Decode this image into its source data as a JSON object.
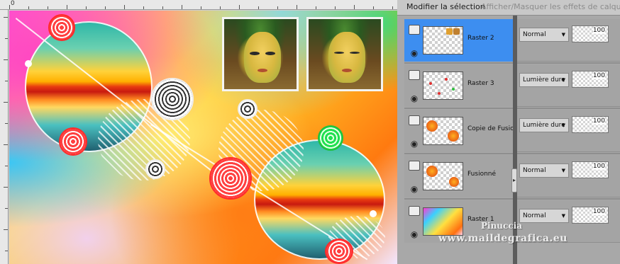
{
  "panel": {
    "tabs": [
      {
        "label": "Modifier la sélection"
      },
      {
        "label": "Afficher/Masquer les effets de calque"
      }
    ],
    "layers": [
      {
        "name": "Raster 2",
        "blend_mode": "Normal",
        "opacity": "100",
        "selected": true
      },
      {
        "name": "Raster 3",
        "blend_mode": "Lumière dure",
        "opacity": "100",
        "selected": false
      },
      {
        "name": "Copie de Fusionn",
        "blend_mode": "Lumière dure",
        "opacity": "100",
        "selected": false
      },
      {
        "name": "Fusionné",
        "blend_mode": "Normal",
        "opacity": "100",
        "selected": false
      },
      {
        "name": "Raster 1",
        "blend_mode": "Normal",
        "opacity": "100",
        "selected": false
      }
    ]
  },
  "ruler": {
    "origin_label": "0"
  },
  "watermark": {
    "line1": "Pinuccia",
    "line2": "www.maildegrafica.eu"
  },
  "colors": {
    "selection": "#3d8ef0",
    "panel_bg": "#a8a8a8"
  }
}
